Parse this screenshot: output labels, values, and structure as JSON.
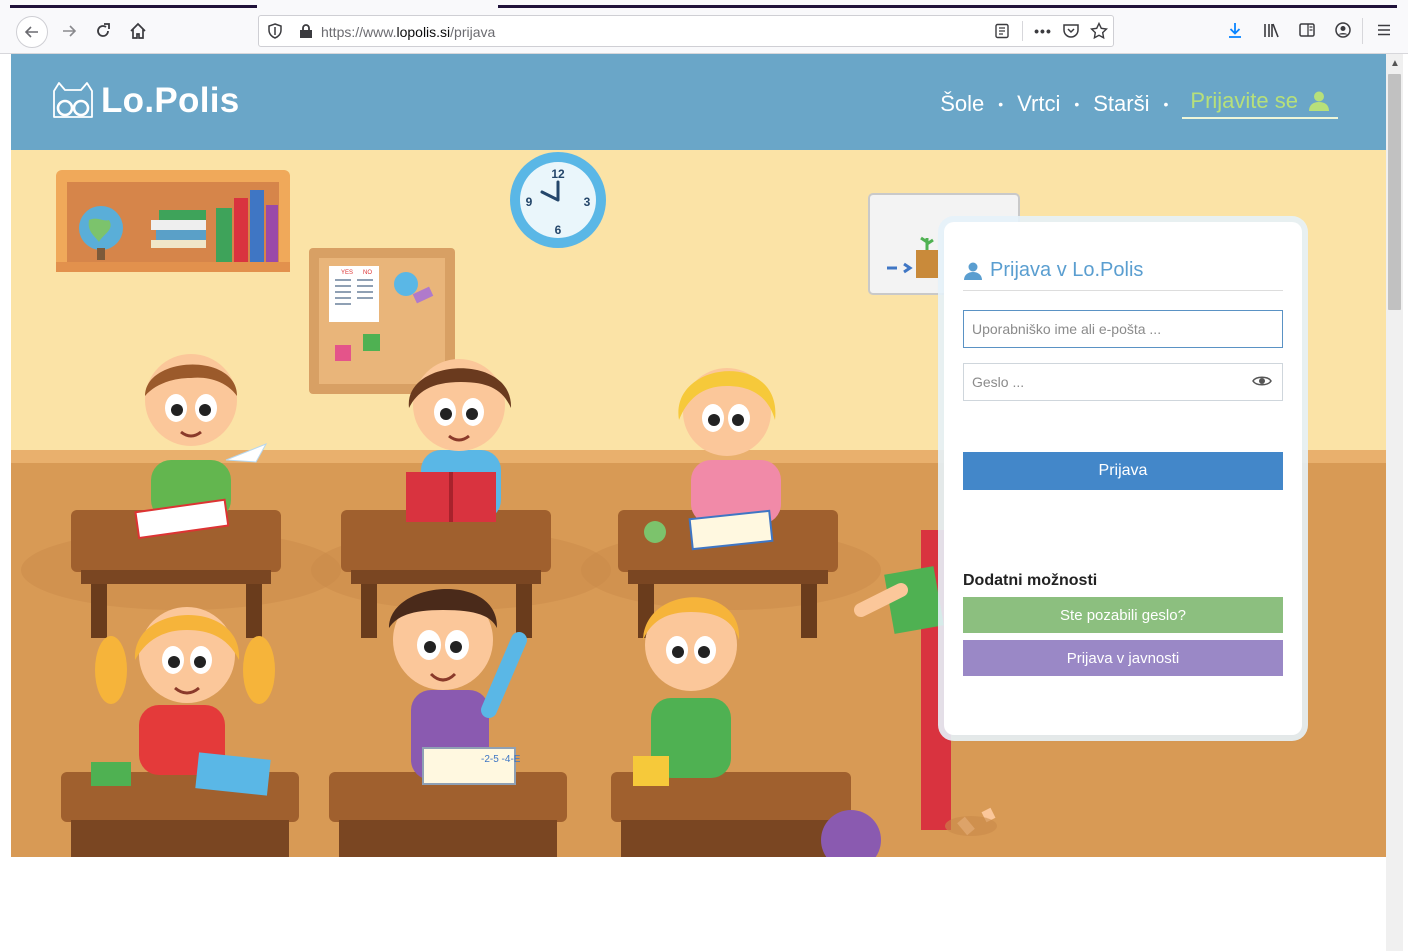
{
  "browser": {
    "url_prefix": "https://www.",
    "url_domain": "lopolis.si",
    "url_path": "/prijava",
    "page_actions_label": "•••"
  },
  "site": {
    "logo_text": "Lo.Polis",
    "nav": [
      {
        "label": "Šole"
      },
      {
        "label": "Vrtci"
      },
      {
        "label": "Starši"
      }
    ],
    "nav_separator": "•",
    "login_link": "Prijavite se",
    "accent_color": "#6aa6c8"
  },
  "login_card": {
    "title": "Prijava v Lo.Polis",
    "username_placeholder": "Uporabniško ime ali e-pošta ...",
    "password_placeholder": "Geslo ...",
    "submit_label": "Prijava",
    "more_title": "Dodatni možnosti",
    "forgot_label": "Ste pozabili geslo?",
    "public_label": "Prijava v javnosti"
  },
  "illustration": {
    "clock_numbers": [
      "12",
      "3",
      "6",
      "9"
    ],
    "board_labels": [
      "YES",
      "NO"
    ],
    "book_scribble": "-2-5 -4-E"
  },
  "icons": [
    "back-icon",
    "forward-icon",
    "reload-icon",
    "home-icon",
    "shield-icon",
    "lock-icon",
    "reader-icon",
    "pocket-icon",
    "bookmark-star-icon",
    "download-icon",
    "library-icon",
    "sidebar-icon",
    "account-icon",
    "hamburger-menu-icon",
    "owl-logo-icon",
    "user-icon",
    "eye-icon"
  ]
}
